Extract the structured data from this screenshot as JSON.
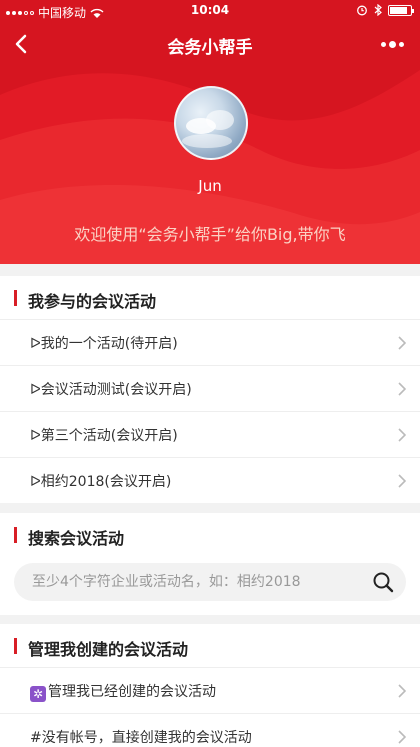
{
  "status_bar": {
    "carrier": "中国移动",
    "time": "10:04",
    "battery_level": 0.85
  },
  "nav": {
    "title": "会务小帮手",
    "back_icon": "chevron-left-icon",
    "more_icon": "more-dots-icon"
  },
  "profile": {
    "name": "Jun",
    "welcome": "欢迎使用“会务小帮手”给你Big,带你飞"
  },
  "joined": {
    "title": "我参与的会议活动",
    "items": [
      {
        "label": "ᐅ我的一个活动(待开启)"
      },
      {
        "label": "ᐅ会议活动测试(会议开启)"
      },
      {
        "label": "ᐅ第三个活动(会议开启)"
      },
      {
        "label": "ᐅ相约2018(会议开启)"
      }
    ]
  },
  "search": {
    "title": "搜索会议活动",
    "placeholder": "至少4个字符企业或活动名，如：相约2018"
  },
  "manage": {
    "title": "管理我创建的会议活动",
    "items": [
      {
        "label": "管理我已经创建的会议活动",
        "icon": "gear-icon"
      },
      {
        "label": "#没有帐号，直接创建我的会议活动"
      }
    ]
  },
  "colors": {
    "brand_red": "#e21b26",
    "accent_bar": "#d81e26"
  }
}
